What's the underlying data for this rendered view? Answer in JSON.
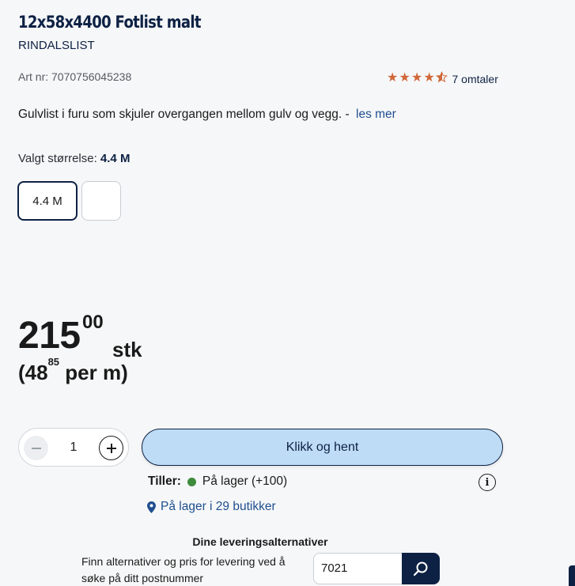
{
  "product": {
    "title": "12x58x4400 Fotlist malt",
    "brand": "RINDALSLIST",
    "art_nr": "Art nr: 7070756045238",
    "rating_value": 4.5,
    "reviews_label": "7 omtaler",
    "description": "Gulvlist i furu som skjuler overgangen mellom gulv og vegg. -",
    "read_more": "les mer"
  },
  "size": {
    "label": "Valgt størrelse:",
    "selected": "4.4 M",
    "options": [
      "4.4 M",
      ""
    ]
  },
  "price": {
    "integer": "215",
    "decimals": "00",
    "unit": "stk",
    "per_open": "(48",
    "per_decimals": "85",
    "per_close": "per m)"
  },
  "purchase": {
    "quantity": "1",
    "cta_label": "Klikk og hent"
  },
  "availability": {
    "store_name": "Tiller:",
    "status": "På lager (+100)",
    "status_color": "#3d8b3d",
    "stores_link": "På lager i 29 butikker"
  },
  "delivery": {
    "title": "Dine leveringsalternativer",
    "text": "Finn alternativer og pris for levering ved å søke på ditt postnummer",
    "postal_value": "7021"
  },
  "colors": {
    "navy": "#0d2144",
    "star": "#d0683a",
    "cta_bg": "#bedcf6",
    "link": "#1f4f8f"
  }
}
